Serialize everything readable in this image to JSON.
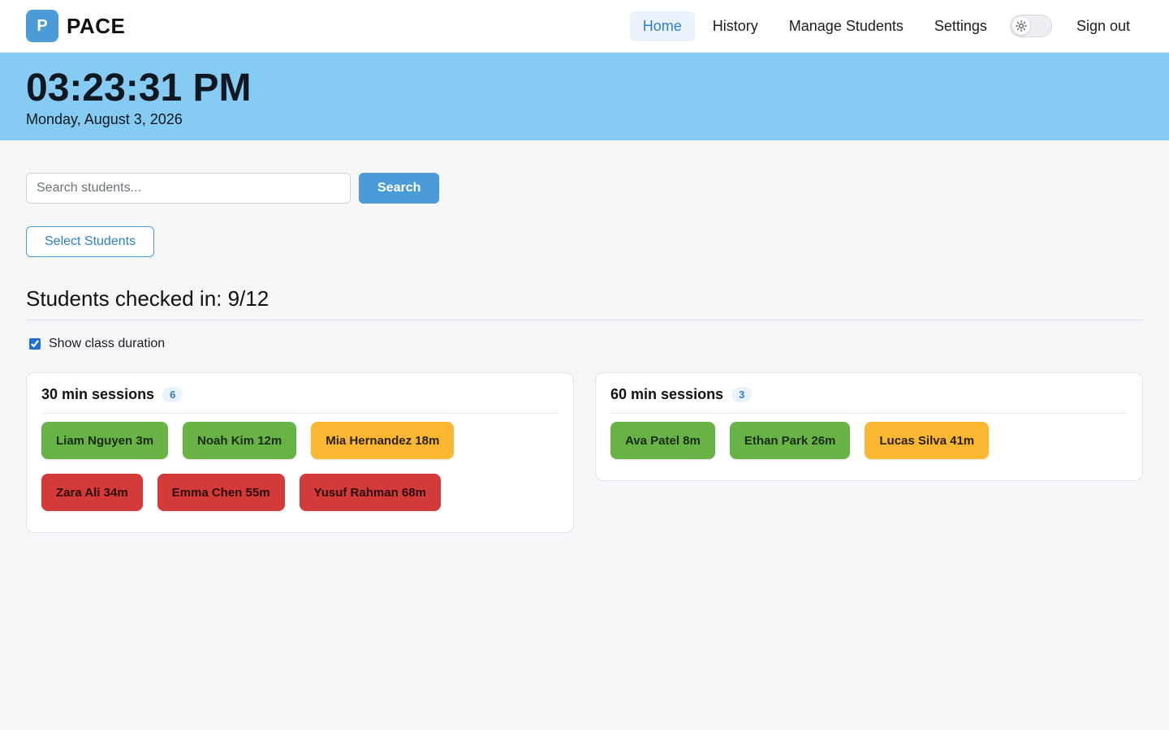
{
  "nav": {
    "brand_letter": "P",
    "brand_name": "PACE",
    "links": [
      "Home",
      "History",
      "Manage Students",
      "Settings"
    ],
    "active": "Home",
    "theme_toggle_icon": "sun-icon",
    "signout_label": "Sign out"
  },
  "clock": {
    "time": "03:23:31 PM",
    "date": "Monday, August 3, 2026"
  },
  "search": {
    "placeholder": "Search students...",
    "button_label": "Search"
  },
  "select_students_label": "Select Students",
  "checked_in": {
    "label": "Students checked in: 9/12"
  },
  "show_duration": {
    "label": "Show class duration",
    "checked": true
  },
  "colors": {
    "accent": "#4a9bd8",
    "banner": "#85cbf3",
    "green": "#67b346",
    "amber": "#fcb732",
    "red": "#d43a3a"
  },
  "groups": [
    {
      "title": "30 min sessions",
      "count": "6",
      "students": [
        {
          "label": "Liam Nguyen 3m",
          "status": "green"
        },
        {
          "label": "Noah Kim 12m",
          "status": "green"
        },
        {
          "label": "Mia Hernandez 18m",
          "status": "amber"
        },
        {
          "label": "Zara Ali 34m",
          "status": "red"
        },
        {
          "label": "Emma Chen 55m",
          "status": "red"
        },
        {
          "label": "Yusuf Rahman 68m",
          "status": "red"
        }
      ]
    },
    {
      "title": "60 min sessions",
      "count": "3",
      "students": [
        {
          "label": "Ava Patel 8m",
          "status": "green"
        },
        {
          "label": "Ethan Park 26m",
          "status": "green"
        },
        {
          "label": "Lucas Silva 41m",
          "status": "amber"
        }
      ]
    }
  ]
}
